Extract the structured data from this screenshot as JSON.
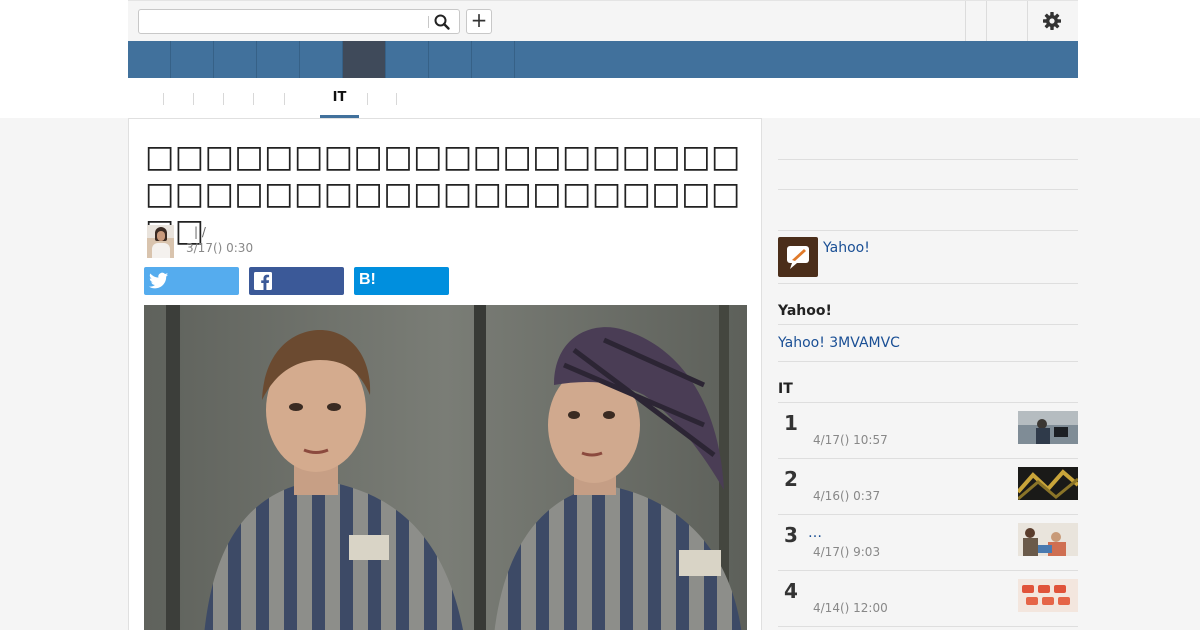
{
  "search": {
    "value": "",
    "placeholder": ""
  },
  "toolbar": {
    "plus_label": "+"
  },
  "nav": {
    "active_index": 5
  },
  "subnav": {
    "active_label": "IT"
  },
  "article": {
    "headline": "□□□□□□□□□□□□□□□□□□□□□□□□□□□□□□□□□□□□□□□□□□",
    "author_sep": "| /",
    "date": "3/17() 0:30"
  },
  "side": {
    "yahoo_link": "Yahoo!",
    "yahoo_heading": "Yahoo!",
    "yahoo_sub": "Yahoo! 3MVAMVC",
    "it_heading": "IT",
    "ranking": [
      {
        "num": "1",
        "title": "",
        "date": "4/17() 10:57"
      },
      {
        "num": "2",
        "title": "",
        "date": "4/16() 0:37"
      },
      {
        "num": "3",
        "title": "…",
        "date": "4/17() 9:03"
      },
      {
        "num": "4",
        "title": "",
        "date": "4/14() 12:00"
      }
    ]
  },
  "colors": {
    "nav_blue": "#41719c",
    "nav_active": "#3f4a5a",
    "link_blue": "#1a4f95",
    "twitter": "#55acee",
    "facebook": "#3b5998",
    "hatena": "#008fde"
  },
  "icons": [
    "search-icon",
    "plus-icon",
    "gear-icon",
    "twitter-icon",
    "facebook-icon",
    "hatena-icon"
  ]
}
